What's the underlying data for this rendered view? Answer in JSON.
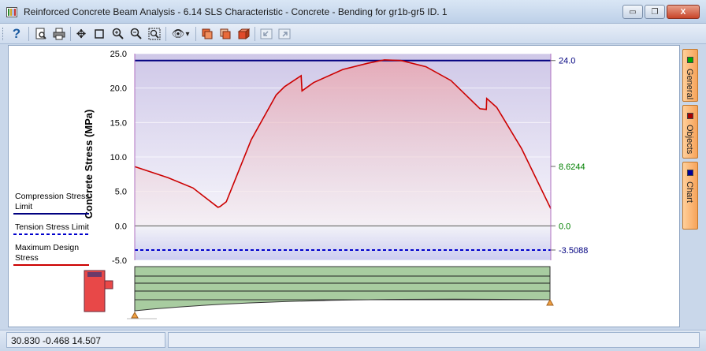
{
  "window": {
    "title": "Reinforced Concrete Beam Analysis - 6.14 SLS Characteristic - Concrete - Bending for gr1b-gr5 ID. 1",
    "minimize_glyph": "▭",
    "restore_glyph": "❐",
    "close_glyph": "X"
  },
  "toolbar": {
    "icons": [
      "help-icon",
      "print-preview-icon",
      "print-icon",
      "pan-icon",
      "select-icon",
      "zoom-in-icon",
      "zoom-out-icon",
      "zoom-extents-icon",
      "view-icon",
      "copy-icon",
      "copy-all-icon",
      "export-icon",
      "nav-back-icon",
      "nav-forward-icon"
    ],
    "help_glyph": "?",
    "pan_glyph": "✥",
    "view_glyph": "👁",
    "dropdown_glyph": "▾"
  },
  "legend": {
    "items": [
      {
        "label": "Compression Stress Limit",
        "line_1": "Compression Stress",
        "line_2": "Limit",
        "style": "solid",
        "color": "#000080"
      },
      {
        "label": "Tension Stress Limit",
        "line_1": "Tension Stress Limit",
        "line_2": "",
        "style": "dashed",
        "color": "#0000cc"
      },
      {
        "label": "Maximum Design Stress",
        "line_1": "Maximum Design",
        "line_2": "Stress",
        "style": "solid",
        "color": "#cc0000"
      }
    ]
  },
  "side_tabs": [
    {
      "label": "General",
      "color": "#00aa00"
    },
    {
      "label": "Objects",
      "color": "#aa0000"
    },
    {
      "label": "Chart",
      "color": "#000099"
    }
  ],
  "status": {
    "coordinates": "30.830  -0.468  14.507"
  },
  "colors": {
    "stress_line": "#cc0000",
    "compression_limit": "#000080",
    "tension_limit": "#0000cc",
    "zero_line": "#555555",
    "beam_fill": "#a8cca0",
    "section_fill": "#e84848",
    "section_top": "#6a3a6a",
    "support": "#f0a040",
    "label_green": "#008000",
    "label_navy": "#000080"
  },
  "chart_data": {
    "type": "line",
    "title": "",
    "xlabel": "",
    "ylabel": "Concrete Stress (MPa)",
    "ylim": [
      -5.0,
      25.0
    ],
    "xlim": [
      0,
      1
    ],
    "yticks": [
      "25.0",
      "20.0",
      "15.0",
      "10.0",
      "5.0",
      "0.0",
      "-5.0"
    ],
    "ytick_values": [
      25,
      20,
      15,
      10,
      5,
      0,
      -5
    ],
    "grid": true,
    "legend_position": "left",
    "right_labels": [
      {
        "value": 24.0,
        "text": "24.0",
        "color": "#000080"
      },
      {
        "value": 8.6244,
        "text": "8.6244",
        "color": "#008000"
      },
      {
        "value": 0.0,
        "text": "0.0",
        "color": "#008000"
      },
      {
        "value": -3.5088,
        "text": "-3.5088",
        "color": "#000080"
      }
    ],
    "series": [
      {
        "name": "Maximum Design Stress",
        "x": [
          0.0,
          0.08,
          0.14,
          0.2,
          0.205,
          0.22,
          0.28,
          0.34,
          0.36,
          0.4,
          0.402,
          0.43,
          0.5,
          0.56,
          0.6,
          0.64,
          0.7,
          0.76,
          0.83,
          0.845,
          0.846,
          0.87,
          0.93,
          1.0
        ],
        "y": [
          8.6,
          7.0,
          5.5,
          2.7,
          2.8,
          3.5,
          12.5,
          19.0,
          20.2,
          21.8,
          19.6,
          20.8,
          22.7,
          23.6,
          24.1,
          24.0,
          23.1,
          21.1,
          17.0,
          16.9,
          18.5,
          17.2,
          11.2,
          2.5
        ]
      },
      {
        "name": "Compression Stress Limit",
        "x": [
          0,
          1
        ],
        "y": [
          24.0,
          24.0
        ]
      },
      {
        "name": "Tension Stress Limit",
        "x": [
          0,
          1
        ],
        "y": [
          -3.5088,
          -3.5088
        ]
      }
    ]
  }
}
